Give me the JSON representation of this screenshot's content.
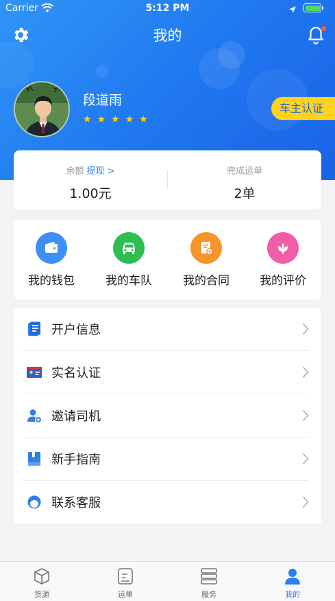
{
  "status_bar": {
    "carrier": "Carrier",
    "time": "5:12 PM",
    "battery_level": 1.0
  },
  "nav": {
    "title": "我的",
    "settings_icon": "gear-icon",
    "notification_icon": "bell-icon",
    "has_unread_dot": true
  },
  "profile": {
    "name": "段道雨",
    "rating": 5,
    "badge_label": "车主认证"
  },
  "stats": {
    "balance_label": "余额",
    "withdraw_label": "提现 >",
    "balance_value": "1.00元",
    "completed_label": "完成运单",
    "completed_value": "2单"
  },
  "quick_actions": [
    {
      "label": "我的钱包",
      "icon": "wallet-icon",
      "color": "#3d8ff5"
    },
    {
      "label": "我的车队",
      "icon": "car-icon",
      "color": "#2ebd4f"
    },
    {
      "label": "我的合同",
      "icon": "contract-icon",
      "color": "#f5962d"
    },
    {
      "label": "我的评价",
      "icon": "flower-icon",
      "color": "#f25ea6"
    }
  ],
  "menu": [
    {
      "label": "开户信息",
      "icon": "document-icon"
    },
    {
      "label": "实名认证",
      "icon": "id-card-icon"
    },
    {
      "label": "邀请司机",
      "icon": "add-user-icon"
    },
    {
      "label": "新手指南",
      "icon": "book-icon"
    },
    {
      "label": "联系客服",
      "icon": "customer-service-icon"
    }
  ],
  "tabs": [
    {
      "label": "货源",
      "icon": "cargo-box-icon",
      "active": false
    },
    {
      "label": "运单",
      "icon": "waybill-icon",
      "active": false
    },
    {
      "label": "服务",
      "icon": "service-icon",
      "active": false
    },
    {
      "label": "我的",
      "icon": "profile-icon",
      "active": true
    }
  ],
  "colors": {
    "header": "#1f76ef",
    "accent": "#2d7ef3",
    "badge": "#ffd21f"
  }
}
